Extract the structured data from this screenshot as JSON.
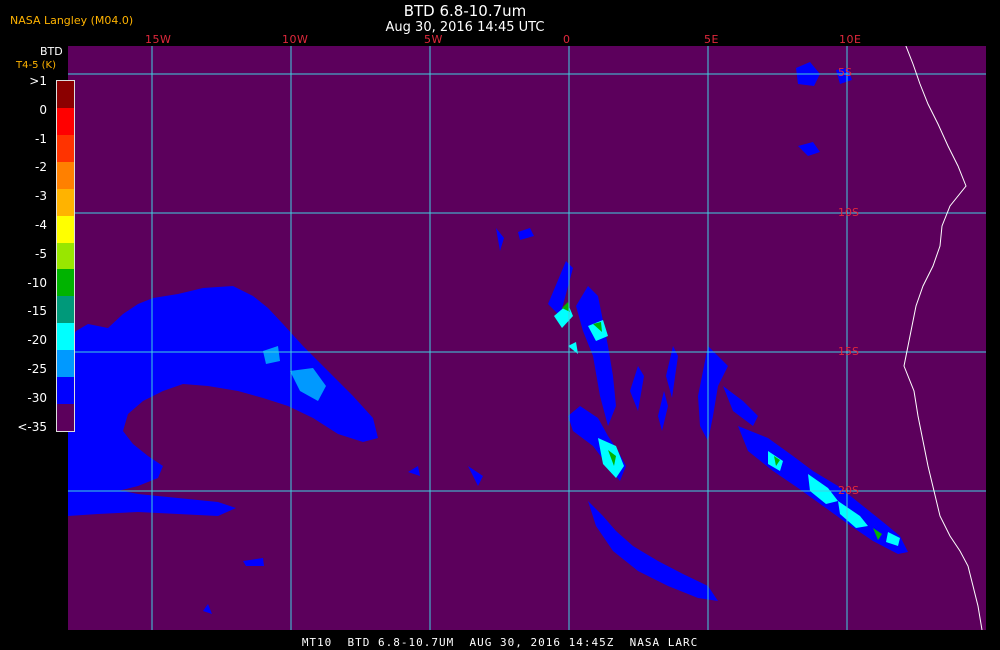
{
  "header": {
    "agency": "NASA Langley (M04.0)",
    "title": "BTD 6.8-10.7um",
    "subtitle": "Aug 30, 2016 14:45 UTC"
  },
  "legend": {
    "title": "BTD",
    "subtitle": "T4-5 (K)",
    "ticks": [
      ">1",
      "0",
      "-1",
      "-2",
      "-3",
      "-4",
      "-5",
      "-10",
      "-15",
      "-20",
      "-25",
      "-30",
      "<-35"
    ],
    "colors": [
      "#8b0000",
      "#ff0000",
      "#ff3300",
      "#ff8000",
      "#ffb300",
      "#ffff00",
      "#99e600",
      "#00b300",
      "#00997a",
      "#00ffff",
      "#0099ff",
      "#0000ff",
      "#5c005c"
    ]
  },
  "map": {
    "longitude_labels": [
      "15W",
      "10W",
      "5W",
      "0",
      "5E",
      "10E"
    ],
    "latitude_labels": [
      "5S",
      "10S",
      "15S",
      "20S"
    ],
    "background_color": "#5c005c",
    "grid_color": "#40d0e0",
    "coast_color": "#ffffff"
  },
  "footer": {
    "text": "MT10  BTD 6.8-10.7UM  AUG 30, 2016 14:45Z  NASA LARC"
  }
}
